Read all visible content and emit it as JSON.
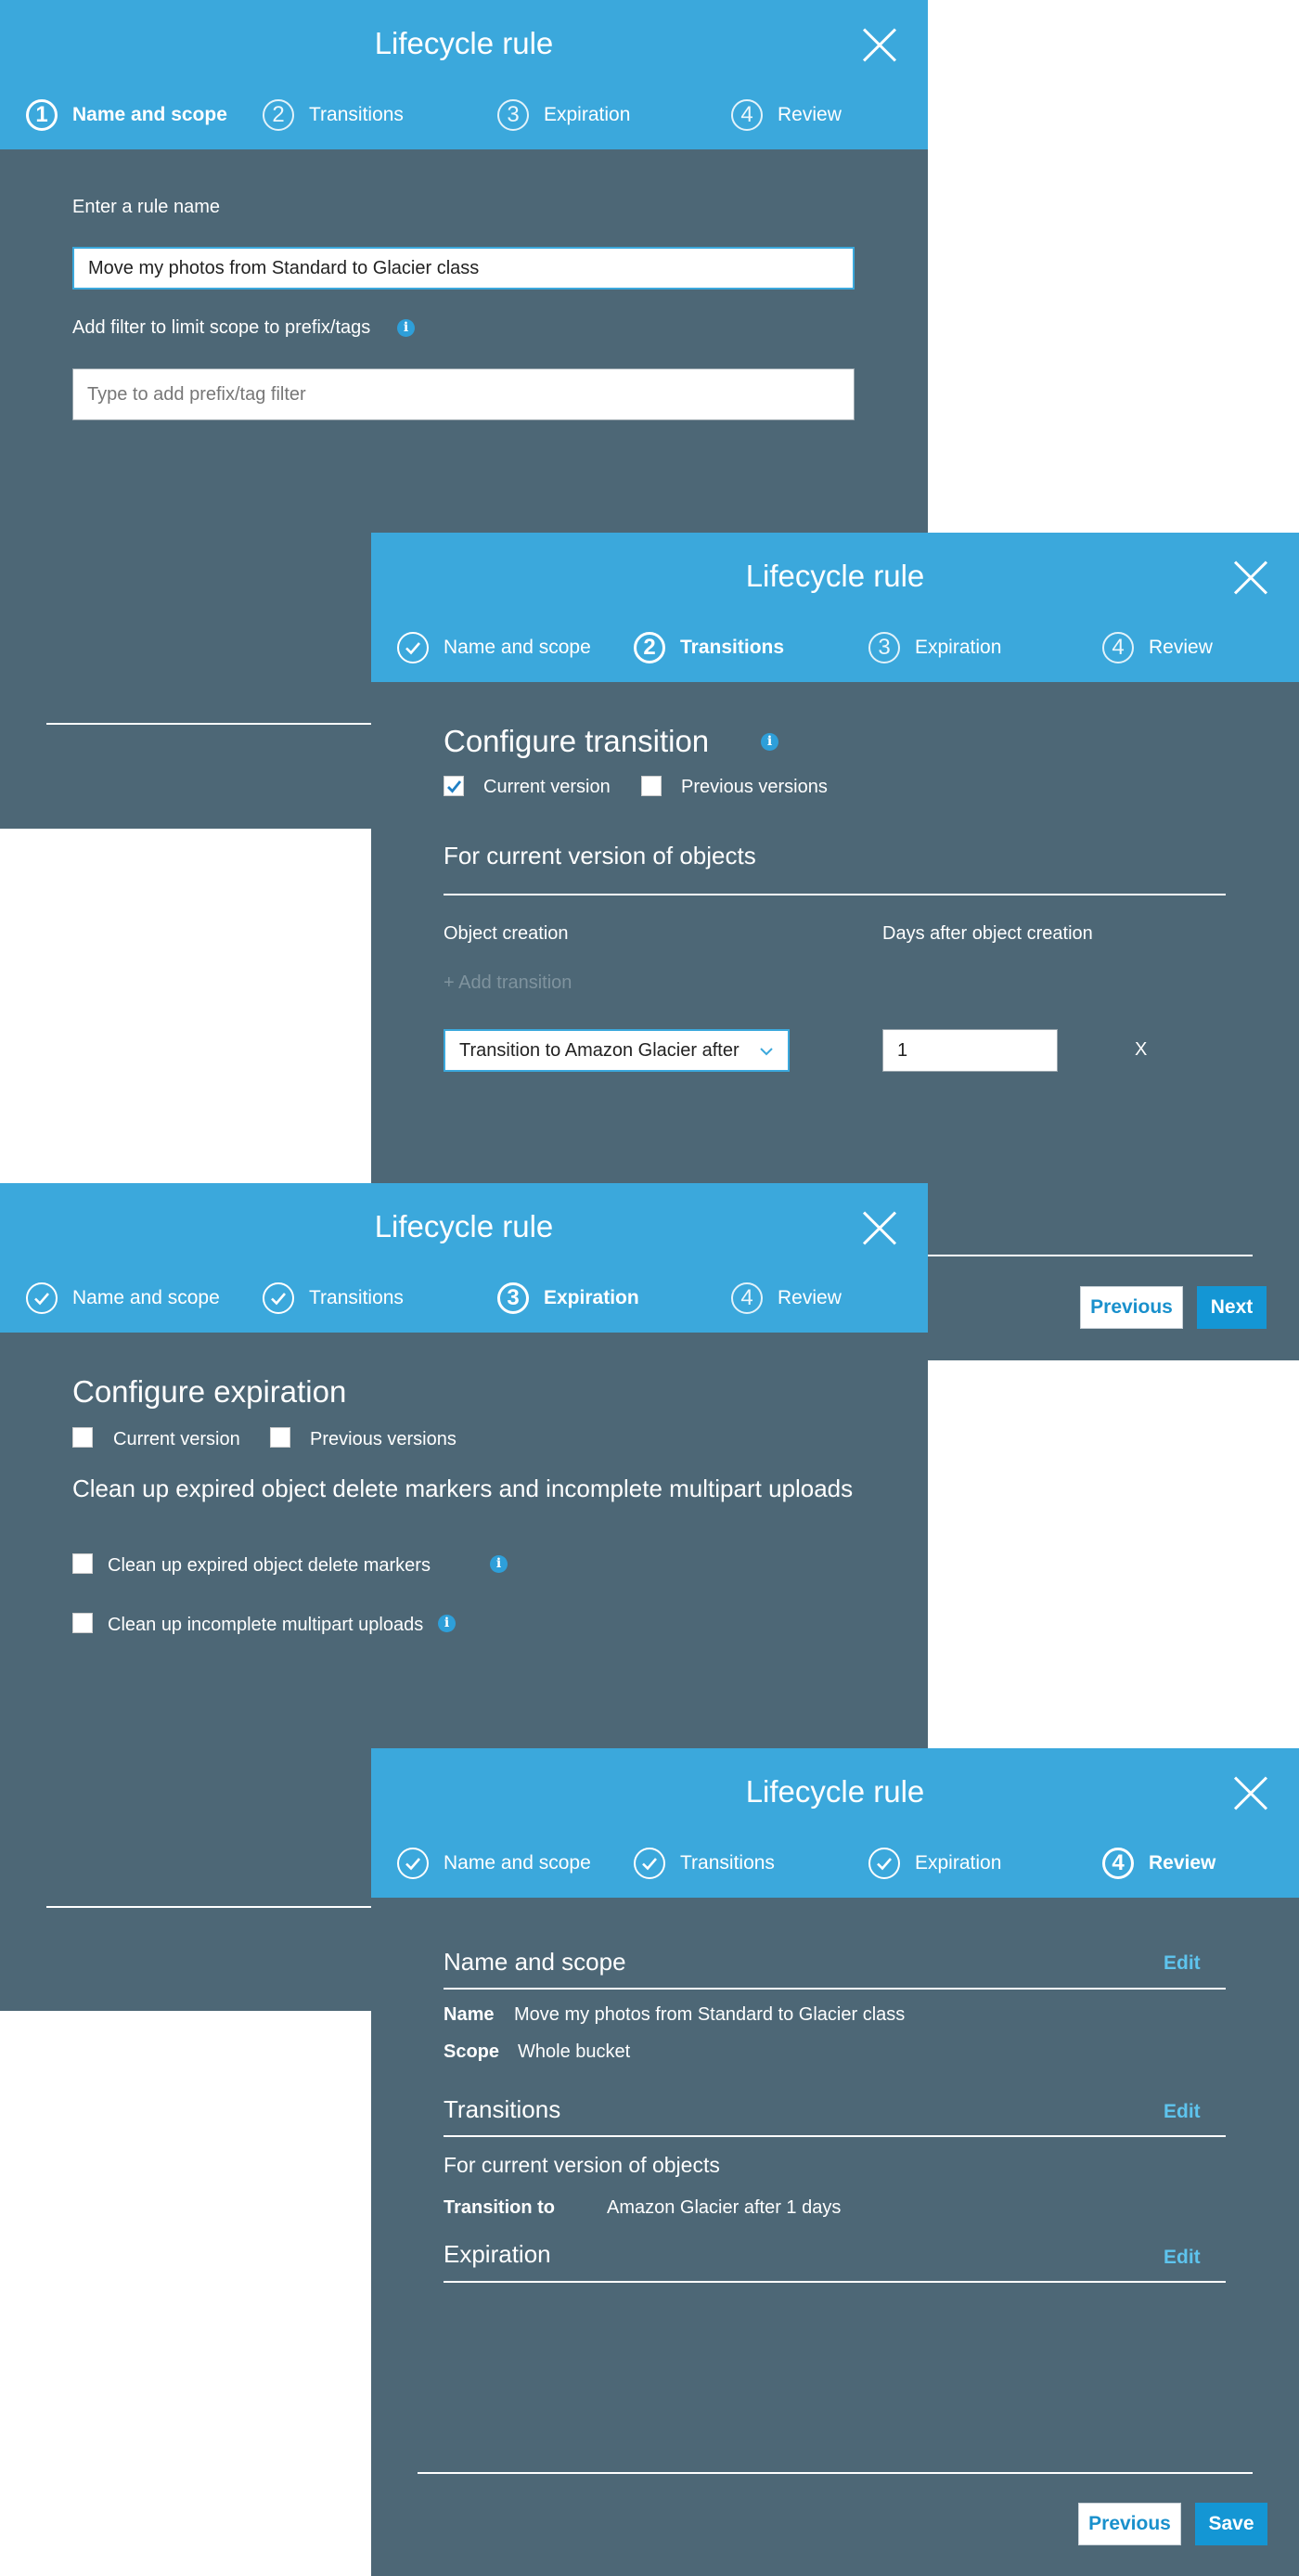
{
  "steps": {
    "name_scope": "Name and scope",
    "transitions": "Transitions",
    "expiration": "Expiration",
    "review": "Review",
    "num1": "1",
    "num2": "2",
    "num3": "3",
    "num4": "4"
  },
  "panel1": {
    "title": "Lifecycle rule",
    "rule_name_label": "Enter a rule name",
    "rule_name_value": "Move my photos from Standard to Glacier class",
    "filter_label": "Add filter to limit scope to prefix/tags",
    "filter_placeholder": "Type to add prefix/tag filter"
  },
  "panel2": {
    "title": "Lifecycle rule",
    "section_title": "Configure transition",
    "current_version": "Current version",
    "current_version_checked": true,
    "previous_versions": "Previous versions",
    "previous_versions_checked": false,
    "subsection_title": "For current version of objects",
    "col_object_creation": "Object creation",
    "col_days": "Days after object creation",
    "add_transition": "+ Add transition",
    "transition_select": "Transition to Amazon Glacier after",
    "days_value": "1",
    "remove_label": "X",
    "previous_button": "Previous",
    "next_button": "Next"
  },
  "panel3": {
    "title": "Lifecycle rule",
    "section_title": "Configure expiration",
    "current_version": "Current version",
    "previous_versions": "Previous versions",
    "cleanup_title": "Clean up expired object delete markers and incomplete multipart uploads",
    "cleanup_markers": "Clean up expired object delete markers",
    "cleanup_multipart": "Clean up incomplete multipart uploads"
  },
  "panel4": {
    "title": "Lifecycle rule",
    "name_scope_heading": "Name and scope",
    "edit": "Edit",
    "name_key": "Name",
    "name_value": "Move my photos from Standard to Glacier class",
    "scope_key": "Scope",
    "scope_value": "Whole bucket",
    "transitions_heading": "Transitions",
    "for_current": "For current version of objects",
    "transition_key": "Transition to",
    "transition_value": "Amazon Glacier after 1 days",
    "expiration_heading": "Expiration",
    "previous_button": "Previous",
    "save_button": "Save"
  }
}
